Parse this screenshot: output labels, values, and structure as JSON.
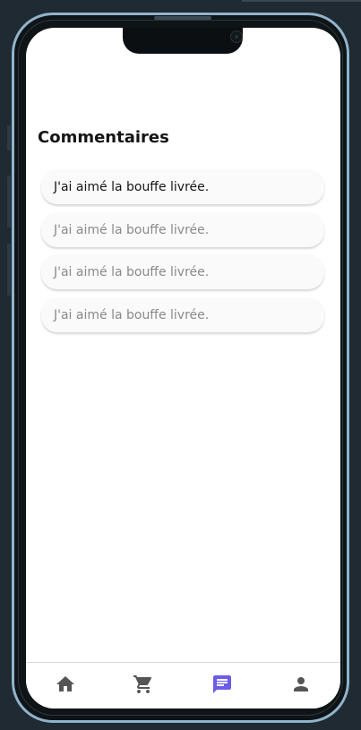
{
  "page": {
    "title": "Commentaires"
  },
  "comments": [
    {
      "text": "J'ai aimé la bouffe livrée.",
      "active": true
    },
    {
      "text": "J'ai aimé la bouffe livrée.",
      "active": false
    },
    {
      "text": "J'ai aimé la bouffe livrée.",
      "active": false
    },
    {
      "text": "J'ai aimé la bouffe livrée.",
      "active": false
    }
  ],
  "tabbar": {
    "items": [
      {
        "icon": "home-icon",
        "color": "#555555"
      },
      {
        "icon": "cart-icon",
        "color": "#555555"
      },
      {
        "icon": "chat-icon",
        "color": "#6c5ce7",
        "active": true
      },
      {
        "icon": "person-icon",
        "color": "#555555"
      }
    ]
  },
  "colors": {
    "accent": "#6c5ce7",
    "frame": "#90b4cc",
    "background": "#1f2a33",
    "text_primary": "#161616",
    "text_muted": "#8a8a8a"
  }
}
